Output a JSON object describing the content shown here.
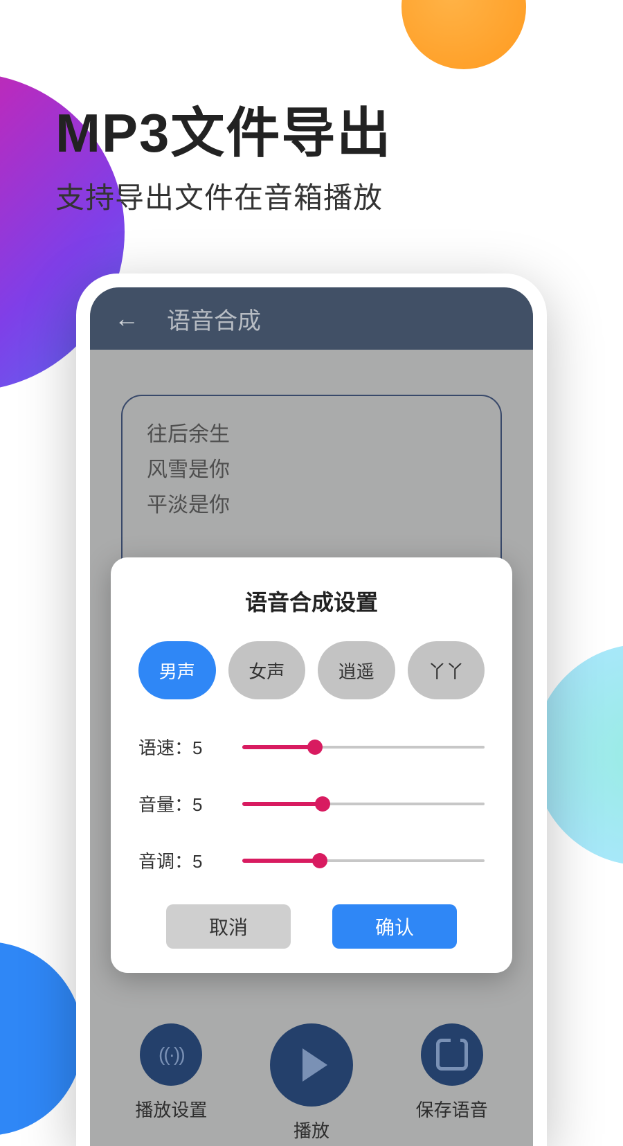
{
  "headline": {
    "title": "MP3文件导出",
    "subtitle": "支持导出文件在音箱播放"
  },
  "app": {
    "title": "语音合成",
    "text_lines": [
      "往后余生",
      "风雪是你",
      "平淡是你"
    ]
  },
  "modal": {
    "title": "语音合成设置",
    "voices": [
      {
        "label": "男声",
        "selected": true
      },
      {
        "label": "女声",
        "selected": false
      },
      {
        "label": "逍遥",
        "selected": false
      },
      {
        "label": "丫丫",
        "selected": false
      }
    ],
    "sliders": [
      {
        "label_prefix": "语速：",
        "value": 5,
        "fill_pct": 30
      },
      {
        "label_prefix": "音量：",
        "value": 5,
        "fill_pct": 33
      },
      {
        "label_prefix": "音调：",
        "value": 5,
        "fill_pct": 32
      }
    ],
    "cancel": "取消",
    "confirm": "确认"
  },
  "bottom": {
    "settings": "播放设置",
    "play": "播放",
    "save": "保存语音"
  }
}
